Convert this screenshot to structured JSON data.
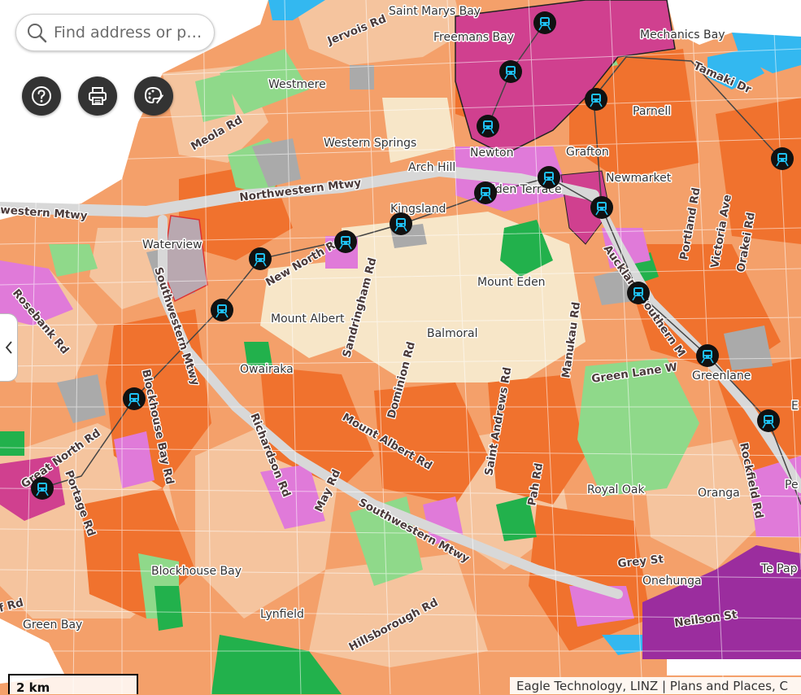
{
  "search": {
    "placeholder": "Find address or p…"
  },
  "tools": [
    {
      "name": "help-button",
      "icon": "question-circle-icon"
    },
    {
      "name": "print-button",
      "icon": "printer-icon"
    },
    {
      "name": "basemap-style-button",
      "icon": "palette-icon"
    }
  ],
  "side_panel": {
    "icon": "chevron-left-icon"
  },
  "scalebar": {
    "label": "2 km"
  },
  "attribution": {
    "text": "Eagle Technology, LINZ | Plans and Places, C"
  },
  "colors": {
    "residential_mixed": "#f4a06a",
    "residential_single": "#f5c49e",
    "terrace_apartment": "#f0722e",
    "open_space": "#8fd98a",
    "park": "#22b14c",
    "business": "#e07ad9",
    "centre": "#d0408f",
    "industrial": "#9b2d9e",
    "water": "#33b8f0",
    "special": "#aaaaaa",
    "motorway": "#d8d8d8"
  },
  "place_labels": [
    {
      "id": "saint-marys-bay",
      "text": "Saint Marys Bay"
    },
    {
      "id": "freemans-bay",
      "text": "Freemans Bay"
    },
    {
      "id": "mechanics-bay",
      "text": "Mechanics Bay"
    },
    {
      "id": "westmere",
      "text": "Westmere"
    },
    {
      "id": "parnell",
      "text": "Parnell"
    },
    {
      "id": "western-springs",
      "text": "Western Springs"
    },
    {
      "id": "newton",
      "text": "Newton"
    },
    {
      "id": "grafton",
      "text": "Grafton"
    },
    {
      "id": "arch-hill",
      "text": "Arch Hill"
    },
    {
      "id": "newmarket",
      "text": "Newmarket"
    },
    {
      "id": "eden-terrace",
      "text": "Eden Terrace"
    },
    {
      "id": "kingsland",
      "text": "Kingsland"
    },
    {
      "id": "waterview",
      "text": "Waterview"
    },
    {
      "id": "mount-eden",
      "text": "Mount Eden"
    },
    {
      "id": "mount-albert",
      "text": "Mount Albert"
    },
    {
      "id": "balmoral",
      "text": "Balmoral"
    },
    {
      "id": "owairaka",
      "text": "Owairaka"
    },
    {
      "id": "greenlane",
      "text": "Greenlane"
    },
    {
      "id": "royal-oak",
      "text": "Royal Oak"
    },
    {
      "id": "oranga",
      "text": "Oranga"
    },
    {
      "id": "onehunga",
      "text": "Onehunga"
    },
    {
      "id": "blockhouse-bay",
      "text": "Blockhouse Bay"
    },
    {
      "id": "lynfield",
      "text": "Lynfield"
    },
    {
      "id": "green-bay",
      "text": "Green Bay"
    },
    {
      "id": "te-papapa",
      "text": "Te Pap"
    },
    {
      "id": "penrose",
      "text": "Pe"
    },
    {
      "id": "ellerslie",
      "text": "E"
    }
  ],
  "road_labels": [
    {
      "id": "jervois-rd",
      "text": "Jervois Rd"
    },
    {
      "id": "tamaki-dr",
      "text": "Tamaki Dr"
    },
    {
      "id": "meola-rd",
      "text": "Meola Rd"
    },
    {
      "id": "northwestern-mtwy",
      "text": "Northwestern Mtwy"
    },
    {
      "id": "northwestern-mtwy-west",
      "text": "western Mtwy"
    },
    {
      "id": "new-north-rd",
      "text": "New North Rd"
    },
    {
      "id": "southwestern-mtwy-north",
      "text": "Southwestern Mtwy"
    },
    {
      "id": "rosebank-rd",
      "text": "Rosebank Rd"
    },
    {
      "id": "sandringham-rd",
      "text": "Sandringham Rd"
    },
    {
      "id": "dominion-rd",
      "text": "Dominion Rd"
    },
    {
      "id": "manukau-rd",
      "text": "Manukau Rd"
    },
    {
      "id": "portland-rd",
      "text": "Portland Rd"
    },
    {
      "id": "victoria-ave",
      "text": "Victoria Ave"
    },
    {
      "id": "orakei-rd",
      "text": "Orakei Rd"
    },
    {
      "id": "auckland-southern-mtwy",
      "text": "Auckland-Southern M"
    },
    {
      "id": "green-lane-w",
      "text": "Green Lane W"
    },
    {
      "id": "blockhouse-bay-rd",
      "text": "Blockhouse Bay Rd"
    },
    {
      "id": "great-north-rd",
      "text": "Great North Rd"
    },
    {
      "id": "portage-rd",
      "text": "Portage Rd"
    },
    {
      "id": "richardson-rd",
      "text": "Richardson Rd"
    },
    {
      "id": "mount-albert-rd",
      "text": "Mount Albert Rd"
    },
    {
      "id": "saint-andrews-rd",
      "text": "Saint Andrews Rd"
    },
    {
      "id": "pah-rd",
      "text": "Pah Rd"
    },
    {
      "id": "rockfield-rd",
      "text": "Rockfield Rd"
    },
    {
      "id": "may-rd",
      "text": "May Rd"
    },
    {
      "id": "southwestern-mtwy-south",
      "text": "Southwestern Mtwy"
    },
    {
      "id": "grey-st",
      "text": "Grey St"
    },
    {
      "id": "neilson-st",
      "text": "Neilson St"
    },
    {
      "id": "hillsborough-rd",
      "text": "Hillsborough Rd"
    },
    {
      "id": "wolverton-rd",
      "text": "f Rd"
    }
  ]
}
